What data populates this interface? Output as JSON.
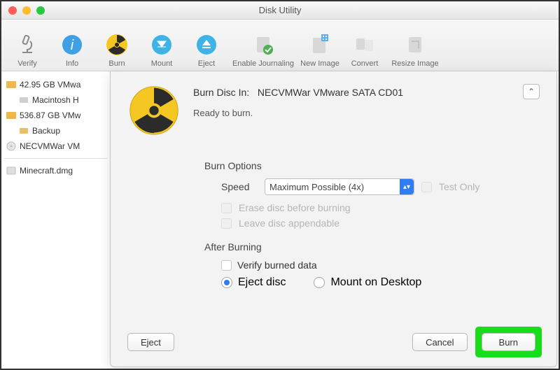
{
  "window": {
    "title": "Disk Utility"
  },
  "toolbar": {
    "items": [
      {
        "label": "Verify"
      },
      {
        "label": "Info"
      },
      {
        "label": "Burn"
      },
      {
        "label": "Mount"
      },
      {
        "label": "Eject"
      },
      {
        "label": "Enable Journaling"
      },
      {
        "label": "New Image"
      },
      {
        "label": "Convert"
      },
      {
        "label": "Resize Image"
      }
    ]
  },
  "sidebar": {
    "disk1": "42.95 GB VMwa",
    "disk1_child": "Macintosh H",
    "disk2": "536.87 GB VMw",
    "disk2_child": "Backup",
    "disc": "NECVMWar VM",
    "dmg": "Minecraft.dmg"
  },
  "dialog": {
    "burn_in_label": "Burn Disc In:",
    "burn_in_value": "NECVMWar VMware SATA CD01",
    "ready": "Ready to burn.",
    "burn_options_title": "Burn Options",
    "speed_label": "Speed",
    "speed_value": "Maximum Possible (4x)",
    "test_only": "Test Only",
    "erase_disc": "Erase disc before burning",
    "leave_appendable": "Leave disc appendable",
    "after_burning_title": "After Burning",
    "verify_data": "Verify burned data",
    "eject_disc": "Eject disc",
    "mount_desktop": "Mount on Desktop",
    "eject_btn": "Eject",
    "cancel_btn": "Cancel",
    "burn_btn": "Burn"
  }
}
